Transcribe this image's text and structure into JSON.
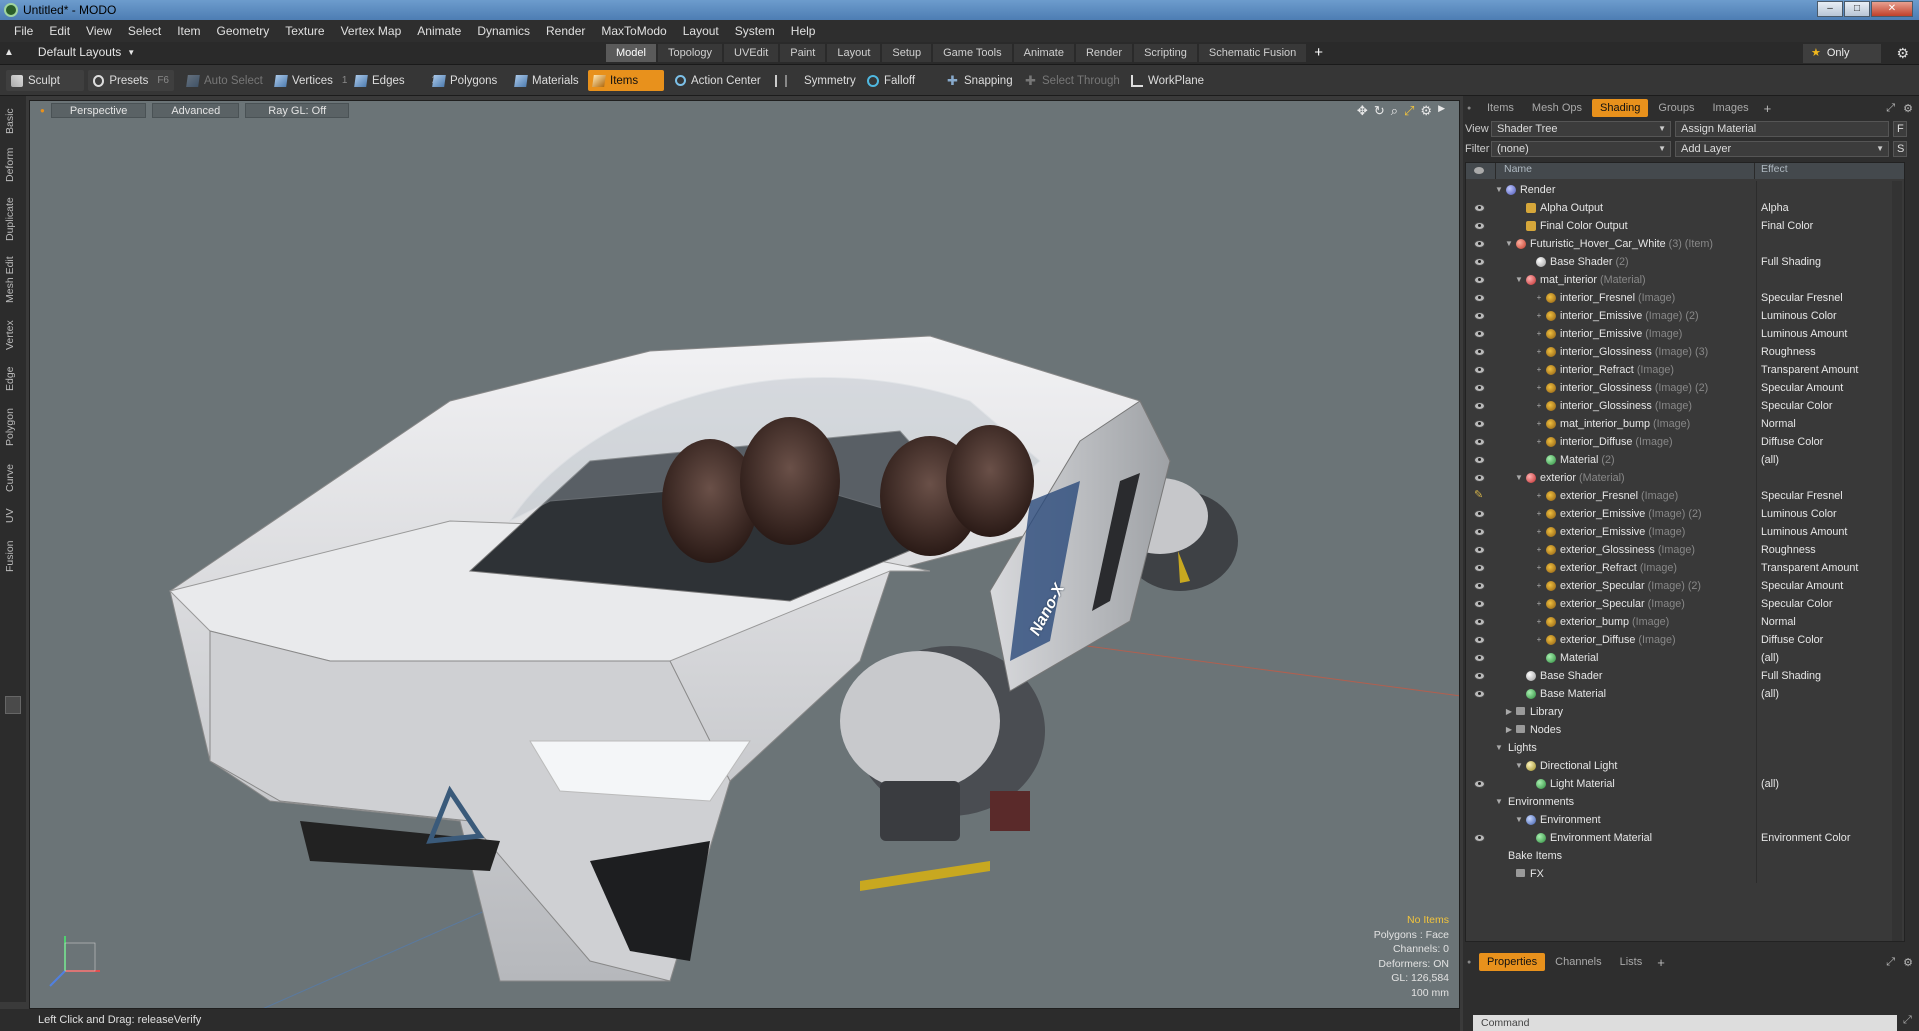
{
  "window": {
    "title": "Untitled* - MODO",
    "minimize": "–",
    "maximize": "□",
    "close": "✕"
  },
  "menu": [
    "File",
    "Edit",
    "View",
    "Select",
    "Item",
    "Geometry",
    "Texture",
    "Vertex Map",
    "Animate",
    "Dynamics",
    "Render",
    "MaxToModo",
    "Layout",
    "System",
    "Help"
  ],
  "layout_bar": {
    "layouts_label": "Default Layouts",
    "tabs": [
      {
        "label": "Model",
        "active": true
      },
      {
        "label": "Topology"
      },
      {
        "label": "UVEdit"
      },
      {
        "label": "Paint"
      },
      {
        "label": "Layout"
      },
      {
        "label": "Setup"
      },
      {
        "label": "Game Tools"
      },
      {
        "label": "Animate"
      },
      {
        "label": "Render"
      },
      {
        "label": "Scripting"
      },
      {
        "label": "Schematic Fusion"
      }
    ],
    "add_tab": "+",
    "only_label": "Only"
  },
  "toolbar": {
    "sculpt": "Sculpt",
    "presets": "Presets",
    "presets_key": "F6",
    "auto_select": "Auto Select",
    "vertices": "Vertices",
    "vertices_key": "1",
    "edges": "Edges",
    "edges_key": "2",
    "polygons": "Polygons",
    "materials": "Materials",
    "items": "Items",
    "action_center": "Action Center",
    "symmetry": "Symmetry",
    "falloff": "Falloff",
    "snapping": "Snapping",
    "select_through": "Select Through",
    "workplane": "WorkPlane"
  },
  "left_tabs": [
    "Basic",
    "Deform",
    "Duplicate",
    "Mesh Edit",
    "Vertex",
    "Edge",
    "Polygon",
    "Curve",
    "UV",
    "Fusion"
  ],
  "viewport": {
    "view_mode": "Perspective",
    "advanced": "Advanced",
    "raygl": "Ray GL: Off",
    "info": {
      "items": "No Items",
      "polygons": "Polygons : Face",
      "channels": "Channels: 0",
      "deformers": "Deformers: ON",
      "gl": "GL: 126,584",
      "scale": "100 mm"
    },
    "car_label": "Nano-X"
  },
  "status": {
    "text": "Left Click and Drag:  releaseVerify"
  },
  "right_panel": {
    "tabs": [
      {
        "label": "Items"
      },
      {
        "label": "Mesh Ops"
      },
      {
        "label": "Shading",
        "active": true
      },
      {
        "label": "Groups"
      },
      {
        "label": "Images"
      }
    ],
    "add_tab": "+",
    "view_label": "View",
    "view_value": "Shader Tree",
    "assign_material": "Assign Material",
    "assign_key": "F",
    "filter_label": "Filter",
    "filter_value": "(none)",
    "add_layer": "Add Layer",
    "add_layer_key": "S",
    "col_name": "Name",
    "col_effect": "Effect",
    "tree": [
      {
        "name": "Render",
        "type": "",
        "effect": "",
        "indent": 0,
        "icon": "sphere",
        "toggle": "▼",
        "eye": false
      },
      {
        "name": "Alpha Output",
        "type": "",
        "effect": "Alpha",
        "indent": 2,
        "icon": "out",
        "toggle": "",
        "eye": true
      },
      {
        "name": "Final Color Output",
        "type": "",
        "effect": "Final Color",
        "indent": 2,
        "icon": "out",
        "toggle": "",
        "eye": true
      },
      {
        "name": "Futuristic_Hover_Car_White",
        "type": "(3) (Item)",
        "effect": "",
        "indent": 1,
        "icon": "item",
        "toggle": "▼",
        "eye": true
      },
      {
        "name": "Base Shader",
        "type": "(2)",
        "effect": "Full Shading",
        "indent": 3,
        "icon": "shader",
        "toggle": "",
        "eye": true
      },
      {
        "name": "mat_interior",
        "type": "(Material)",
        "effect": "",
        "indent": 2,
        "icon": "matr",
        "toggle": "▼",
        "eye": true
      },
      {
        "name": "interior_Fresnel",
        "type": "(Image)",
        "effect": "Specular Fresnel",
        "indent": 4,
        "icon": "img",
        "toggle": "+",
        "eye": true
      },
      {
        "name": "interior_Emissive",
        "type": "(Image) (2)",
        "effect": "Luminous Color",
        "indent": 4,
        "icon": "img",
        "toggle": "+",
        "eye": true
      },
      {
        "name": "interior_Emissive",
        "type": "(Image)",
        "effect": "Luminous Amount",
        "indent": 4,
        "icon": "img",
        "toggle": "+",
        "eye": true
      },
      {
        "name": "interior_Glossiness",
        "type": "(Image) (3)",
        "effect": "Roughness",
        "indent": 4,
        "icon": "img",
        "toggle": "+",
        "eye": true
      },
      {
        "name": "interior_Refract",
        "type": "(Image)",
        "effect": "Transparent Amount",
        "indent": 4,
        "icon": "img",
        "toggle": "+",
        "eye": true
      },
      {
        "name": "interior_Glossiness",
        "type": "(Image) (2)",
        "effect": "Specular Amount",
        "indent": 4,
        "icon": "img",
        "toggle": "+",
        "eye": true
      },
      {
        "name": "interior_Glossiness",
        "type": "(Image)",
        "effect": "Specular Color",
        "indent": 4,
        "icon": "img",
        "toggle": "+",
        "eye": true
      },
      {
        "name": "mat_interior_bump",
        "type": "(Image)",
        "effect": "Normal",
        "indent": 4,
        "icon": "img",
        "toggle": "+",
        "eye": true
      },
      {
        "name": "interior_Diffuse",
        "type": "(Image)",
        "effect": "Diffuse Color",
        "indent": 4,
        "icon": "img",
        "toggle": "+",
        "eye": true
      },
      {
        "name": "Material",
        "type": "(2)",
        "effect": "(all)",
        "indent": 4,
        "icon": "mat",
        "toggle": "",
        "eye": true
      },
      {
        "name": "exterior",
        "type": "(Material)",
        "effect": "",
        "indent": 2,
        "icon": "matr",
        "toggle": "▼",
        "eye": true
      },
      {
        "name": "exterior_Fresnel",
        "type": "(Image)",
        "effect": "Specular Fresnel",
        "indent": 4,
        "icon": "img",
        "toggle": "+",
        "eye": false,
        "pen": true
      },
      {
        "name": "exterior_Emissive",
        "type": "(Image) (2)",
        "effect": "Luminous Color",
        "indent": 4,
        "icon": "img",
        "toggle": "+",
        "eye": true
      },
      {
        "name": "exterior_Emissive",
        "type": "(Image)",
        "effect": "Luminous Amount",
        "indent": 4,
        "icon": "img",
        "toggle": "+",
        "eye": true
      },
      {
        "name": "exterior_Glossiness",
        "type": "(Image)",
        "effect": "Roughness",
        "indent": 4,
        "icon": "img",
        "toggle": "+",
        "eye": true
      },
      {
        "name": "exterior_Refract",
        "type": "(Image)",
        "effect": "Transparent Amount",
        "indent": 4,
        "icon": "img",
        "toggle": "+",
        "eye": true
      },
      {
        "name": "exterior_Specular",
        "type": "(Image) (2)",
        "effect": "Specular Amount",
        "indent": 4,
        "icon": "img",
        "toggle": "+",
        "eye": true
      },
      {
        "name": "exterior_Specular",
        "type": "(Image)",
        "effect": "Specular Color",
        "indent": 4,
        "icon": "img",
        "toggle": "+",
        "eye": true
      },
      {
        "name": "exterior_bump",
        "type": "(Image)",
        "effect": "Normal",
        "indent": 4,
        "icon": "img",
        "toggle": "+",
        "eye": true
      },
      {
        "name": "exterior_Diffuse",
        "type": "(Image)",
        "effect": "Diffuse Color",
        "indent": 4,
        "icon": "img",
        "toggle": "+",
        "eye": true
      },
      {
        "name": "Material",
        "type": "",
        "effect": "(all)",
        "indent": 4,
        "icon": "mat",
        "toggle": "",
        "eye": true
      },
      {
        "name": "Base Shader",
        "type": "",
        "effect": "Full Shading",
        "indent": 2,
        "icon": "shader",
        "toggle": "",
        "eye": true
      },
      {
        "name": "Base Material",
        "type": "",
        "effect": "(all)",
        "indent": 2,
        "icon": "mat",
        "toggle": "",
        "eye": true
      },
      {
        "name": "Library",
        "type": "",
        "effect": "",
        "indent": 1,
        "icon": "folder",
        "toggle": "▶",
        "eye": false
      },
      {
        "name": "Nodes",
        "type": "",
        "effect": "",
        "indent": 1,
        "icon": "folder",
        "toggle": "▶",
        "eye": false
      },
      {
        "name": "Lights",
        "type": "",
        "effect": "",
        "indent": 0,
        "icon": "",
        "toggle": "▼",
        "eye": false
      },
      {
        "name": "Directional Light",
        "type": "",
        "effect": "",
        "indent": 2,
        "icon": "light",
        "toggle": "▼",
        "eye": false
      },
      {
        "name": "Light Material",
        "type": "",
        "effect": "(all)",
        "indent": 3,
        "icon": "mat",
        "toggle": "",
        "eye": true
      },
      {
        "name": "Environments",
        "type": "",
        "effect": "",
        "indent": 0,
        "icon": "",
        "toggle": "▼",
        "eye": false
      },
      {
        "name": "Environment",
        "type": "",
        "effect": "",
        "indent": 2,
        "icon": "env",
        "toggle": "▼",
        "eye": false
      },
      {
        "name": "Environment Material",
        "type": "",
        "effect": "Environment Color",
        "indent": 3,
        "icon": "mat",
        "toggle": "",
        "eye": true
      },
      {
        "name": "Bake Items",
        "type": "",
        "effect": "",
        "indent": 0,
        "icon": "",
        "toggle": "",
        "eye": false
      },
      {
        "name": "FX",
        "type": "",
        "effect": "",
        "indent": 1,
        "icon": "folder",
        "toggle": "",
        "eye": false
      }
    ],
    "bottom_tabs": [
      {
        "label": "Properties",
        "active": true
      },
      {
        "label": "Channels"
      },
      {
        "label": "Lists"
      }
    ],
    "bottom_add": "+",
    "command_placeholder": "Command"
  },
  "colors": {
    "accent": "#e8911c",
    "viewport_bg": "#6b7477",
    "info_highlight": "#f2c43c"
  }
}
